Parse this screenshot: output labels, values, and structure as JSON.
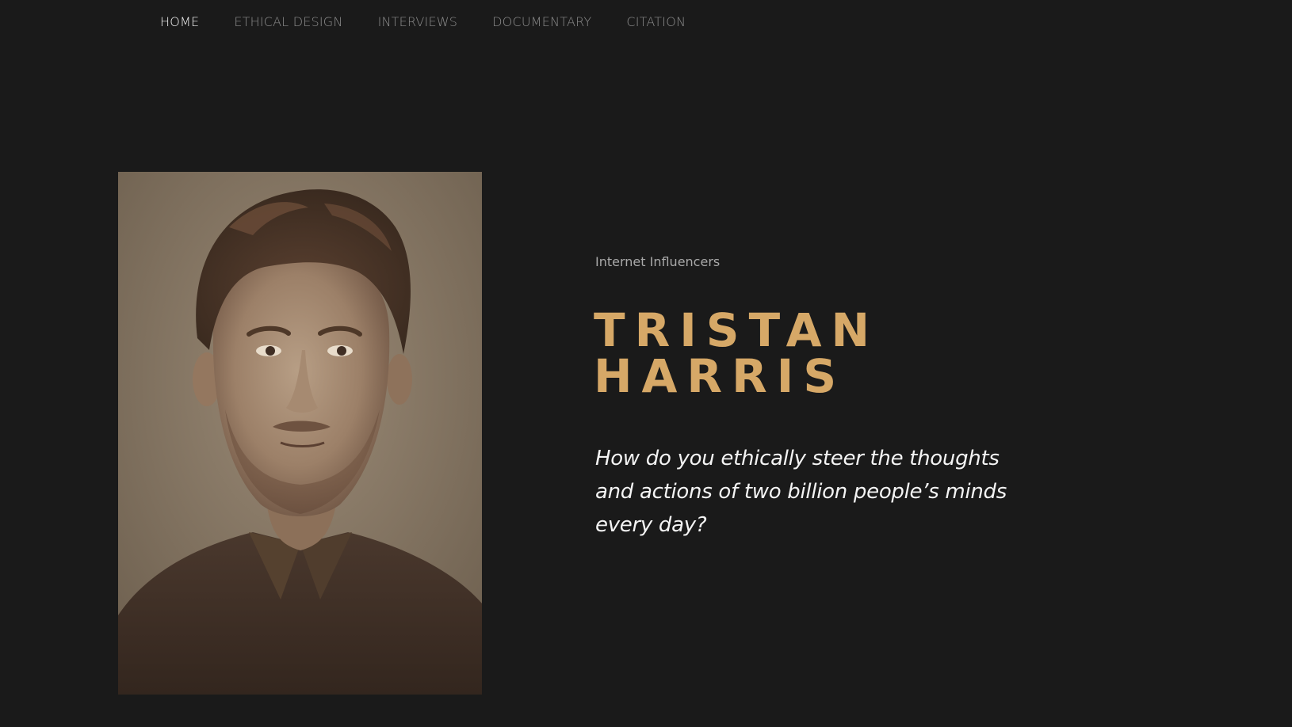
{
  "nav": {
    "items": [
      {
        "label": "HOME",
        "active": true
      },
      {
        "label": "ETHICAL DESIGN",
        "active": false
      },
      {
        "label": "INTERVIEWS",
        "active": false
      },
      {
        "label": "DOCUMENTARY",
        "active": false
      },
      {
        "label": "CITATION",
        "active": false
      }
    ]
  },
  "hero": {
    "category": "Internet Influencers",
    "name_line1": "TRISTAN",
    "name_line2": "HARRIS",
    "quote": "How do you ethically steer the thoughts and actions of two billion people’s minds every day?"
  },
  "colors": {
    "background": "#1a1a1a",
    "accent_gold": "#d6a867",
    "nav_active": "#f2f2f2",
    "nav_inactive": "#8c8c8c",
    "category_text": "#a9a9a9",
    "quote_text": "#f4f4f4"
  },
  "icons": {
    "portrait": "sepia-portrait-photo"
  }
}
